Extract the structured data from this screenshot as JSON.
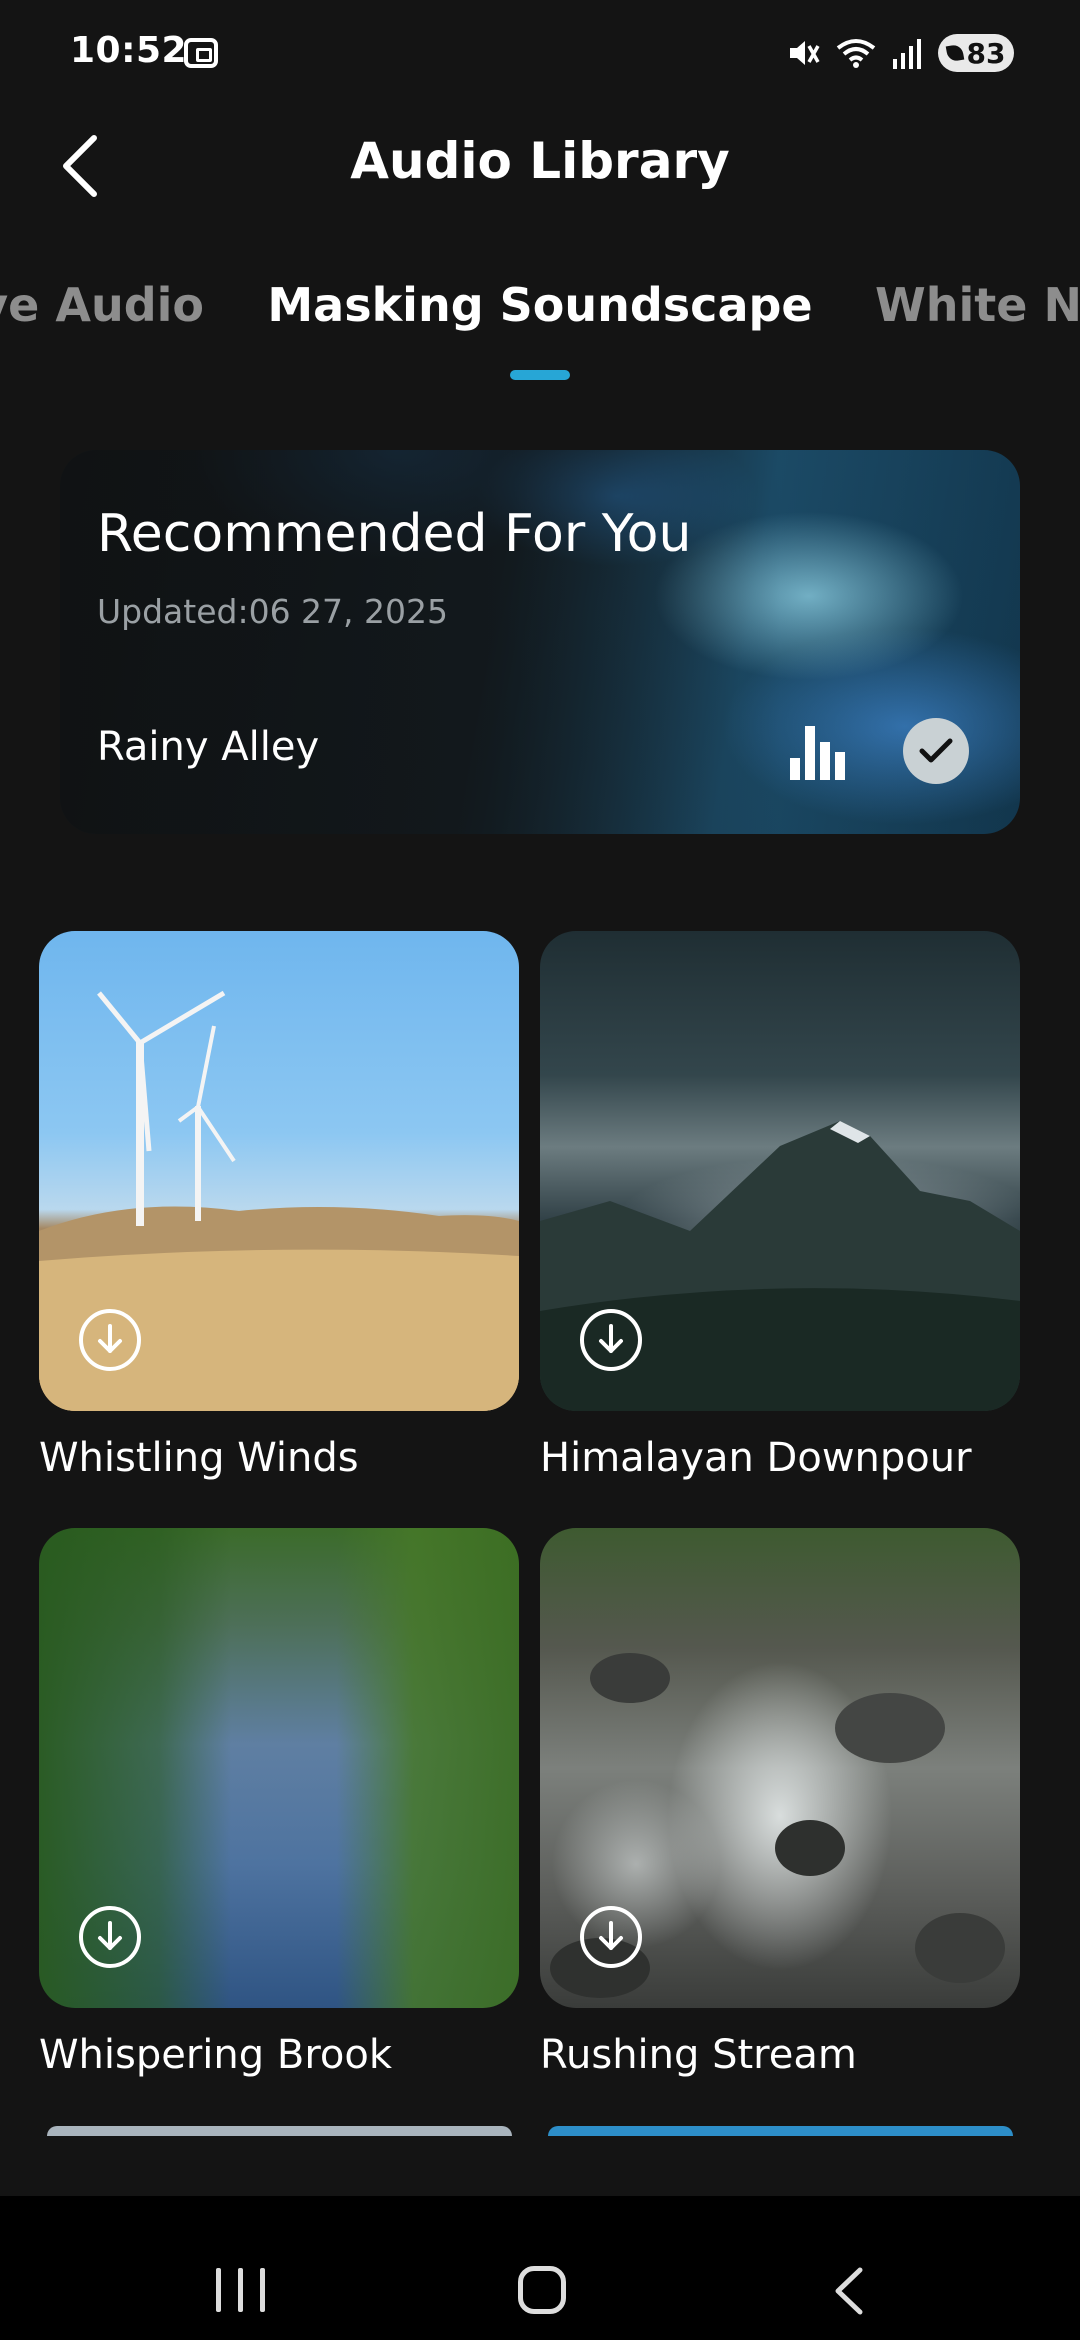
{
  "status_bar": {
    "time": "10:52",
    "battery": "83"
  },
  "header": {
    "title": "Audio Library"
  },
  "tabs": [
    {
      "label": "ve Audio"
    },
    {
      "label": "Masking Soundscape",
      "active": true
    },
    {
      "label": "White No"
    }
  ],
  "recommended": {
    "title": "Recommended For You",
    "updated": "Updated:06 27, 2025",
    "track": "Rainy Alley"
  },
  "sounds": [
    {
      "title": "Whistling Winds"
    },
    {
      "title": "Himalayan Downpour"
    },
    {
      "title": "Whispering Brook"
    },
    {
      "title": "Rushing Stream"
    }
  ],
  "colors": {
    "accent": "#27a6d6",
    "background": "#141414",
    "inactive_tab": "#8d8d8d"
  },
  "icons": {
    "status": [
      "screenshot-icon",
      "mute-icon",
      "wifi-icon",
      "signal-icon",
      "battery-icon"
    ],
    "header": "back-chevron-icon",
    "card": [
      "equalizer-bars-icon",
      "check-icon"
    ],
    "tile": "download-icon",
    "nav": [
      "recents-icon",
      "home-icon",
      "back-icon"
    ]
  }
}
